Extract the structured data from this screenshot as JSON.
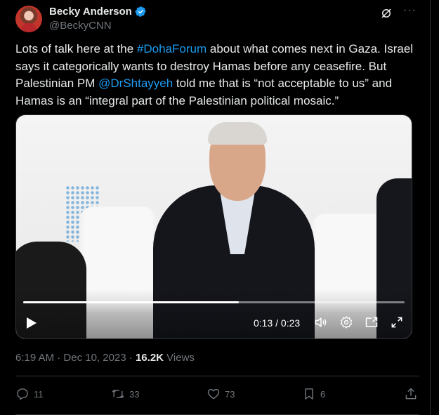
{
  "author": {
    "display_name": "Becky Anderson",
    "handle": "@BeckyCNN",
    "verified": true
  },
  "header_icons": [
    "grok-icon",
    "more-icon"
  ],
  "more_label": "···",
  "tweet": {
    "text_1": "Lots of talk here at the ",
    "hashtag": "#DohaForum",
    "text_2": " about what comes next in Gaza. Israel says it categorically wants to destroy Hamas before any ceasefire. But Palestinian PM ",
    "mention": "@DrShtayyeh",
    "text_3": " told me that is “not acceptable to us” and Hamas is an “integral part of the Palestinian political mosaic.”"
  },
  "video": {
    "time": "0:13 / 0:23",
    "progress": 0.565,
    "controls": [
      "play-icon",
      "volume-icon",
      "settings-icon",
      "pip-icon",
      "fullscreen-icon"
    ]
  },
  "meta": {
    "time": "6:19 AM",
    "separator": " · ",
    "date": "Dec 10, 2023",
    "views_count": "16.2K",
    "views_label": " Views"
  },
  "actions": {
    "replies": "11",
    "reposts": "33",
    "likes": "73",
    "bookmarks": "6"
  },
  "colors": {
    "background": "#000000",
    "text": "#e7e9ea",
    "muted": "#71767b",
    "link": "#1d9bf0",
    "verified": "#1d9bf0",
    "border": "#2f3336"
  }
}
